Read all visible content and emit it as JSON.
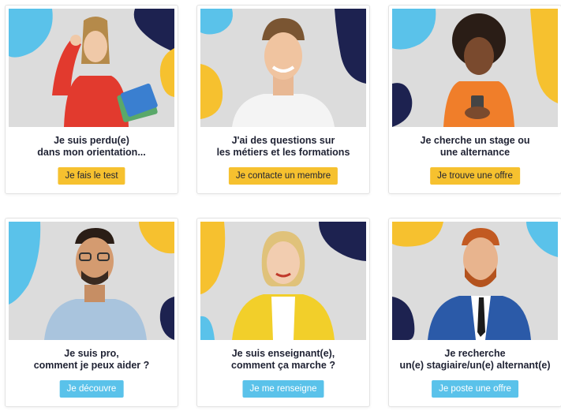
{
  "colors": {
    "yellow": "#f6c12f",
    "blue": "#5ac2ea",
    "navy": "#1d2250",
    "text": "#1f2233"
  },
  "cards": [
    {
      "line1": "Je suis perdu(e)",
      "line2": "dans mon orientation...",
      "button": "Je fais le test",
      "button_style": "yellow",
      "photo": "young-woman-confused-with-books"
    },
    {
      "line1": "J'ai des questions sur",
      "line2": "les métiers et les formations",
      "button": "Je contacte un membre",
      "button_style": "yellow",
      "photo": "smiling-young-man"
    },
    {
      "line1": "Je cherche un stage ou",
      "line2": "une alternance",
      "button": "Je trouve une offre",
      "button_style": "yellow",
      "photo": "young-woman-with-phone"
    },
    {
      "line1": "Je suis pro,",
      "line2": "comment je peux aider ?",
      "button": "Je découvre",
      "button_style": "blue",
      "photo": "man-with-glasses"
    },
    {
      "line1": "Je suis enseignant(e),",
      "line2": "comment ça marche ?",
      "button": "Je me renseigne",
      "button_style": "blue",
      "photo": "blonde-woman-yellow-cardigan"
    },
    {
      "line1": "Je recherche",
      "line2": "un(e) stagiaire/un(e) alternant(e)",
      "button": "Je poste une offre",
      "button_style": "blue",
      "photo": "bearded-man-blue-suit"
    }
  ]
}
